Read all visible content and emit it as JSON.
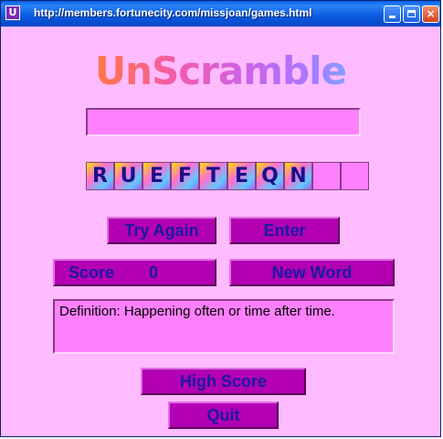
{
  "window": {
    "title": "http://members.fortunecity.com/missjoan/games.html",
    "app_icon_letter": "U",
    "minimize_icon": "minimize-icon",
    "maximize_icon": "maximize-icon",
    "close_icon": "close-icon",
    "close_label": "×"
  },
  "game": {
    "logo": "UnScramble",
    "answer_value": "",
    "scrambled_letters": [
      "R",
      "U",
      "E",
      "F",
      "T",
      "E",
      "Q",
      "N",
      "",
      ""
    ],
    "try_again_label": "Try Again",
    "enter_label": "Enter",
    "score_label": "Score",
    "score_value": "0",
    "new_word_label": "New Word",
    "definition": "Definition: Happening often or time after time.",
    "high_score_label": "High Score",
    "quit_label": "Quit"
  },
  "colors": {
    "background": "#ffbbff",
    "button": "#b300b3",
    "button_text": "#1a1aa0",
    "field": "#ff80ff"
  }
}
